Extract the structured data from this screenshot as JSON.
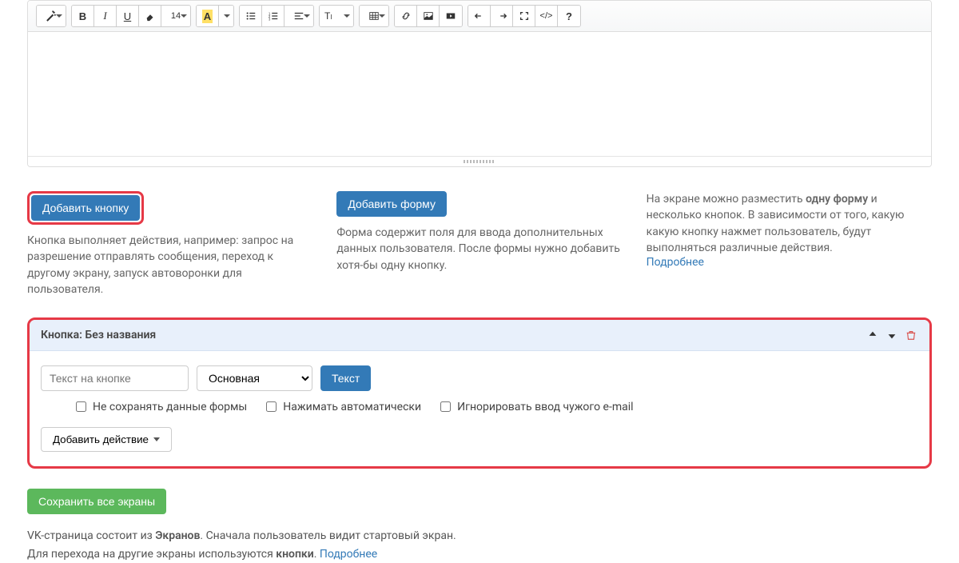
{
  "toolbar_labels": {
    "font_size": "14"
  },
  "add_button": {
    "title": "Добавить кнопку",
    "desc": "Кнопка выполняет действия, например: запрос на разрешение отправлять сообщения, переход к другому экрану, запуск автоворонки для пользователя."
  },
  "add_form": {
    "title": "Добавить форму",
    "desc": "Форма содержит поля для ввода дополнительных данных пользователя. После формы нужно добавить хотя-бы одну кнопку."
  },
  "info": {
    "text1": "На экране можно разместить ",
    "bold1": "одну форму",
    "text2": " и несколько кнопок. В зависимости от того, какую какую кнопку нажмет пользователь, будут выполняться различные действия.",
    "more": "Подробнее"
  },
  "button_panel": {
    "title_prefix": "Кнопка: ",
    "title_name": "Без названия",
    "text_placeholder": "Текст на кнопке",
    "style_options": [
      "Основная"
    ],
    "text_btn": "Текст",
    "chk1": "Не сохранять данные формы",
    "chk2": "Нажимать автоматически",
    "chk3": "Игнорировать ввод чужого e-mail",
    "add_action": "Добавить действие"
  },
  "save_all": "Сохранить все экраны",
  "footer": {
    "l1a": "VK-страница состоит из ",
    "l1b": "Экранов",
    "l1c": ". Сначала пользователь видит стартовый экран.",
    "l2a": "Для перехода на другие экраны используются ",
    "l2b": "кнопки",
    "l2c": ". ",
    "more": "Подробнее"
  }
}
